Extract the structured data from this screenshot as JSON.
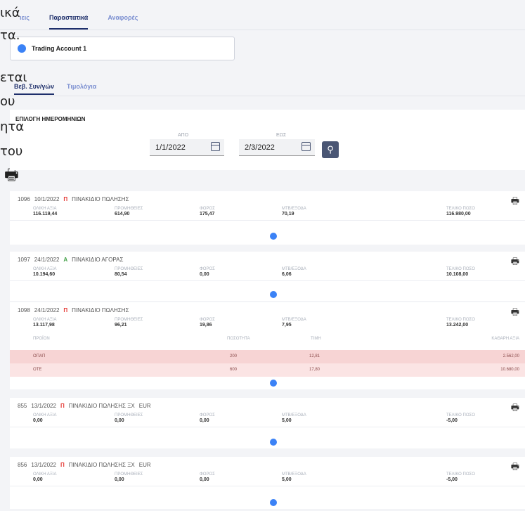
{
  "leak_text": [
    "ικά",
    "τα.",
    "εται",
    "ου",
    "ητα",
    "του"
  ],
  "nav": {
    "tabs": [
      {
        "label": "Κινήσεις",
        "visible": "ιεις"
      },
      {
        "label": "Παραστατικά"
      },
      {
        "label": "Αναφορές"
      }
    ]
  },
  "account": {
    "name": "Trading Account 1"
  },
  "subnav": {
    "tabs": [
      {
        "label": "Βεβ. Συν/γών"
      },
      {
        "label": "Τιμολόγια"
      }
    ]
  },
  "dates": {
    "title": "ΕΠΙΛΟΓΗ ΗΜΕΡΟΜΗΝΙΩΝ",
    "from_label": "ΑΠΟ",
    "from_value": "1/1/2022",
    "to_label": "ΕΩΣ",
    "to_value": "2/3/2022"
  },
  "labels": {
    "total": "ΟΛΙΚΗ ΑΞΙΑ",
    "commission": "ΠΡΟΜΗΘΕΙΕΣ",
    "tax": "ΦΟΡΟΣ",
    "fees": "ΜΤΒ/ΕΞΟΔΑ",
    "final": "ΤΕΛΙΚΟ ΠΟΣΟ",
    "product": "ΠΡΟΪΟΝ",
    "qty": "ΠΟΣΟΤΗΤΑ",
    "price": "ΤΙΜΗ",
    "net": "ΚΑΘΑΡΗ ΑΞΙΑ"
  },
  "cards": [
    {
      "id": "1096",
      "date": "10/1/2022",
      "code": "Π",
      "type": "ΠΙΝΑΚΙΔΙΟ ΠΩΛΗΣΗΣ",
      "currency": "",
      "total": "116.119,44",
      "commission": "614,90",
      "tax": "175,47",
      "fees": "70,19",
      "final": "116.980,00"
    },
    {
      "id": "1097",
      "date": "24/1/2022",
      "code": "Α",
      "type": "ΠΙΝΑΚΙΔΙΟ ΑΓΟΡΑΣ",
      "currency": "",
      "total": "10.194,60",
      "commission": "80,54",
      "tax": "0,00",
      "fees": "6,06",
      "final": "10.108,00"
    },
    {
      "id": "1098",
      "date": "24/1/2022",
      "code": "Π",
      "type": "ΠΙΝΑΚΙΔΙΟ ΠΩΛΗΣΗΣ",
      "currency": "",
      "total": "13.117,98",
      "commission": "96,21",
      "tax": "19,86",
      "fees": "7,95",
      "final": "13.242,00",
      "items": [
        {
          "product": "ΟΠΑΠ",
          "qty": "200",
          "price": "12,81",
          "net": "2.562,00"
        },
        {
          "product": "ΟΤΕ",
          "qty": "600",
          "price": "17,80",
          "net": "10.680,00"
        }
      ]
    },
    {
      "id": "855",
      "date": "13/1/2022",
      "code": "Π",
      "type": "ΠΙΝΑΚΙΔΙΟ ΠΩΛΗΣΗΣ ΞΧ",
      "currency": "EUR",
      "total": "0,00",
      "commission": "0,00",
      "tax": "0,00",
      "fees": "5,00",
      "final": "-5,00"
    },
    {
      "id": "856",
      "date": "13/1/2022",
      "code": "Π",
      "type": "ΠΙΝΑΚΙΔΙΟ ΠΩΛΗΣΗΣ ΞΧ",
      "currency": "EUR",
      "total": "0,00",
      "commission": "0,00",
      "tax": "0,00",
      "fees": "5,00",
      "final": "-5,00"
    }
  ]
}
